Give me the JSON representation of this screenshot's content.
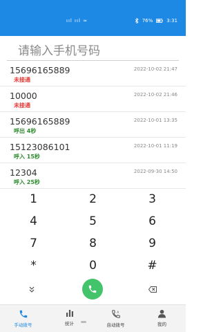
{
  "status_bar": {
    "signal_text": "ııl ııl ≈",
    "battery": "76%",
    "time": "3:31",
    "icons": [
      "signal-icon",
      "wifi-icon",
      "bluetooth-icon",
      "battery-icon"
    ]
  },
  "input": {
    "placeholder": "请输入手机号码",
    "value": ""
  },
  "call_log": [
    {
      "number": "15696165889",
      "status": "未接通",
      "time": "2022-10-02 21:47",
      "status_color": "#e53935"
    },
    {
      "number": "10000",
      "status": "未接通",
      "time": "2022-10-02 21:46",
      "status_color": "#e53935"
    },
    {
      "number": "15696165889",
      "status": "呼出 4秒",
      "time": "2022-10-01 13:35",
      "status_color": "#2e8b2e"
    },
    {
      "number": "15123086101",
      "status": "呼入 15秒",
      "time": "2022-10-01 11:19",
      "status_color": "#2e8b2e"
    },
    {
      "number": "12304",
      "status": "呼入 25秒",
      "time": "2022-09-30 14:50",
      "status_color": "#2e8b2e"
    }
  ],
  "keypad": {
    "keys": [
      "1",
      "2",
      "3",
      "4",
      "5",
      "6",
      "7",
      "8",
      "9",
      "*",
      "0",
      "#"
    ],
    "collapse_icon": "chevron-down-icon",
    "call_icon": "phone-icon",
    "delete_icon": "backspace-icon"
  },
  "tabs": [
    {
      "label": "手动拨号",
      "icon": "phone-icon",
      "active": true
    },
    {
      "label": "统计",
      "icon": "bar-chart-icon",
      "active": false
    },
    {
      "label": "自动拨号",
      "icon": "auto-dial-icon",
      "active": false
    },
    {
      "label": "我的",
      "icon": "user-icon",
      "active": false
    }
  ],
  "colors": {
    "accent": "#1e88e5",
    "missed": "#e53935",
    "connected": "#2e8b2e",
    "call_button": "#43c46b"
  }
}
